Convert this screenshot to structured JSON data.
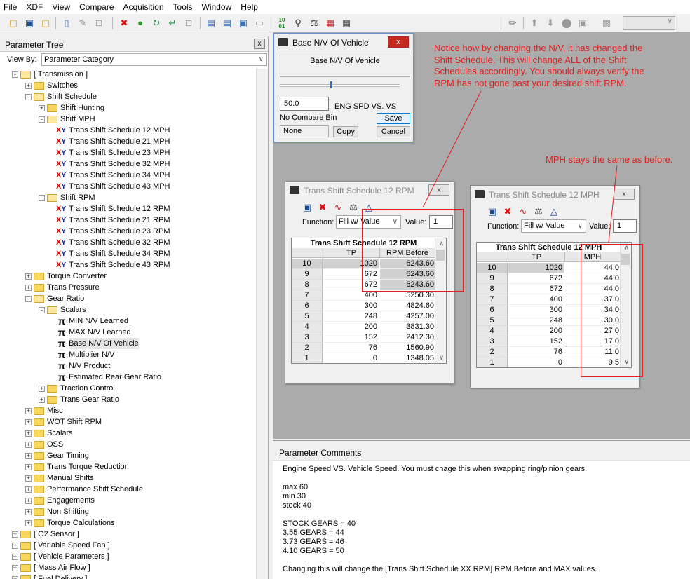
{
  "menu": [
    "File",
    "XDF",
    "View",
    "Compare",
    "Acquisition",
    "Tools",
    "Window",
    "Help"
  ],
  "left_panel": {
    "title": "Parameter Tree",
    "close_glyph": "x",
    "view_by_label": "View By:",
    "view_by_value": "Parameter Category"
  },
  "tree": [
    {
      "label": "[ Transmission ]",
      "icon": "folder-open",
      "level": 0,
      "exp": "-"
    },
    {
      "label": "Switches",
      "icon": "folder",
      "level": 1,
      "exp": "+"
    },
    {
      "label": "Shift Schedule",
      "icon": "folder-open",
      "level": 1,
      "exp": "-"
    },
    {
      "label": "Shift Hunting",
      "icon": "folder",
      "level": 2,
      "exp": "+"
    },
    {
      "label": "Shift MPH",
      "icon": "folder-open",
      "level": 2,
      "exp": "-"
    },
    {
      "label": "Trans Shift Schedule 12 MPH",
      "icon": "xy",
      "level": 3
    },
    {
      "label": "Trans Shift Schedule 21 MPH",
      "icon": "xy",
      "level": 3
    },
    {
      "label": "Trans Shift Schedule 23 MPH",
      "icon": "xy",
      "level": 3
    },
    {
      "label": "Trans Shift Schedule 32 MPH",
      "icon": "xy",
      "level": 3
    },
    {
      "label": "Trans Shift Schedule 34 MPH",
      "icon": "xy",
      "level": 3
    },
    {
      "label": "Trans Shift Schedule 43 MPH",
      "icon": "xy",
      "level": 3
    },
    {
      "label": "Shift RPM",
      "icon": "folder-open",
      "level": 2,
      "exp": "-"
    },
    {
      "label": "Trans Shift Schedule 12 RPM",
      "icon": "xy",
      "level": 3
    },
    {
      "label": "Trans Shift Schedule 21 RPM",
      "icon": "xy",
      "level": 3
    },
    {
      "label": "Trans Shift Schedule 23 RPM",
      "icon": "xy",
      "level": 3
    },
    {
      "label": "Trans Shift Schedule 32 RPM",
      "icon": "xy",
      "level": 3
    },
    {
      "label": "Trans Shift Schedule 34 RPM",
      "icon": "xy",
      "level": 3
    },
    {
      "label": "Trans Shift Schedule 43 RPM",
      "icon": "xy",
      "level": 3
    },
    {
      "label": "Torque Converter",
      "icon": "folder",
      "level": 1,
      "exp": "+"
    },
    {
      "label": "Trans Pressure",
      "icon": "folder",
      "level": 1,
      "exp": "+"
    },
    {
      "label": "Gear Ratio",
      "icon": "folder-open",
      "level": 1,
      "exp": "-"
    },
    {
      "label": "Scalars",
      "icon": "folder-open",
      "level": 2,
      "exp": "-"
    },
    {
      "label": "MIN N/V Learned",
      "icon": "pi",
      "level": 3
    },
    {
      "label": "MAX N/V Learned",
      "icon": "pi",
      "level": 3
    },
    {
      "label": "Base N/V Of Vehicle",
      "icon": "pi",
      "level": 3,
      "selected": true
    },
    {
      "label": "Multiplier N/V",
      "icon": "pi",
      "level": 3
    },
    {
      "label": "N/V Product",
      "icon": "pi",
      "level": 3
    },
    {
      "label": "Estimated Rear Gear Ratio",
      "icon": "pi",
      "level": 3
    },
    {
      "label": "Traction Control",
      "icon": "folder",
      "level": 2,
      "exp": "+"
    },
    {
      "label": "Trans Gear Ratio",
      "icon": "folder",
      "level": 2,
      "exp": "+"
    },
    {
      "label": "Misc",
      "icon": "folder",
      "level": 1,
      "exp": "+"
    },
    {
      "label": "WOT Shift RPM",
      "icon": "folder",
      "level": 1,
      "exp": "+"
    },
    {
      "label": "Scalars",
      "icon": "folder",
      "level": 1,
      "exp": "+"
    },
    {
      "label": "OSS",
      "icon": "folder",
      "level": 1,
      "exp": "+"
    },
    {
      "label": "Gear Timing",
      "icon": "folder",
      "level": 1,
      "exp": "+"
    },
    {
      "label": "Trans Torque Reduction",
      "icon": "folder",
      "level": 1,
      "exp": "+"
    },
    {
      "label": "Manual Shifts",
      "icon": "folder",
      "level": 1,
      "exp": "+"
    },
    {
      "label": "Performance Shift Schedule",
      "icon": "folder",
      "level": 1,
      "exp": "+"
    },
    {
      "label": "Engagements",
      "icon": "folder",
      "level": 1,
      "exp": "+"
    },
    {
      "label": "Non Shifting",
      "icon": "folder",
      "level": 1,
      "exp": "+"
    },
    {
      "label": "Torque Calculations",
      "icon": "folder",
      "level": 1,
      "exp": "+"
    },
    {
      "label": "[ O2 Sensor ]",
      "icon": "folder",
      "level": 0,
      "exp": "+"
    },
    {
      "label": "[ Variable Speed Fan ]",
      "icon": "folder",
      "level": 0,
      "exp": "+"
    },
    {
      "label": "[ Vehicle Parameters ]",
      "icon": "folder",
      "level": 0,
      "exp": "+"
    },
    {
      "label": "[ Mass Air Flow ]",
      "icon": "folder",
      "level": 0,
      "exp": "+"
    },
    {
      "label": "[ Fuel Delivery ]",
      "icon": "folder",
      "level": 0,
      "exp": "+"
    }
  ],
  "base_nv_window": {
    "title": "Base N/V Of Vehicle",
    "field_label": "Base N/V Of Vehicle",
    "value": "50.0",
    "unit_label": "ENG SPD VS. VS",
    "compare_label": "No Compare Bin",
    "compare_value": "None",
    "save_label": "Save",
    "copy_label": "Copy",
    "cancel_label": "Cancel",
    "close_glyph": "x"
  },
  "rpm_window": {
    "title": "Trans Shift Schedule 12 RPM",
    "function_label": "Function:",
    "function_value": "Fill w/ Value",
    "value_label": "Value:",
    "value": "1",
    "table_title": "Trans Shift Schedule 12 RPM",
    "col1": "TP",
    "col2": "RPM Before",
    "rows": [
      {
        "idx": "10",
        "tp": "1020",
        "val": "6243.60"
      },
      {
        "idx": "9",
        "tp": "672",
        "val": "6243.60"
      },
      {
        "idx": "8",
        "tp": "672",
        "val": "6243.60"
      },
      {
        "idx": "7",
        "tp": "400",
        "val": "5250.30"
      },
      {
        "idx": "6",
        "tp": "300",
        "val": "4824.60"
      },
      {
        "idx": "5",
        "tp": "248",
        "val": "4257.00"
      },
      {
        "idx": "4",
        "tp": "200",
        "val": "3831.30"
      },
      {
        "idx": "3",
        "tp": "152",
        "val": "2412.30"
      },
      {
        "idx": "2",
        "tp": "76",
        "val": "1560.90"
      },
      {
        "idx": "1",
        "tp": "0",
        "val": "1348.05"
      }
    ],
    "close_glyph": "x"
  },
  "mph_window": {
    "title": "Trans Shift Schedule 12 MPH",
    "function_label": "Function:",
    "function_value": "Fill w/ Value",
    "value_label": "Value:",
    "value": "1",
    "table_title": "Trans Shift Schedule 12 MPH",
    "col1": "TP",
    "col2": "MPH",
    "rows": [
      {
        "idx": "10",
        "tp": "1020",
        "val": "44.0"
      },
      {
        "idx": "9",
        "tp": "672",
        "val": "44.0"
      },
      {
        "idx": "8",
        "tp": "672",
        "val": "44.0"
      },
      {
        "idx": "7",
        "tp": "400",
        "val": "37.0"
      },
      {
        "idx": "6",
        "tp": "300",
        "val": "34.0"
      },
      {
        "idx": "5",
        "tp": "248",
        "val": "30.0"
      },
      {
        "idx": "4",
        "tp": "200",
        "val": "27.0"
      },
      {
        "idx": "3",
        "tp": "152",
        "val": "17.0"
      },
      {
        "idx": "2",
        "tp": "76",
        "val": "11.0"
      },
      {
        "idx": "1",
        "tp": "0",
        "val": "9.5"
      }
    ],
    "close_glyph": "x"
  },
  "annotations": {
    "top": [
      "Notice how by changing the N/V, it has changed the",
      "Shift Schedule. This will change ALL of the Shift",
      "Schedules accordingly. You should always verify the",
      "RPM has not gone past your desired shift RPM."
    ],
    "mph": "MPH stays the same as before.",
    "color": "#e02020"
  },
  "comments": {
    "title": "Parameter Comments",
    "lines": [
      "Engine Speed VS. Vehicle Speed. You must chage this when swapping ring/pinion gears.",
      "",
      "max 60",
      "min 30",
      "stock 40",
      "",
      "STOCK GEARS = 40",
      "3.55 GEARS = 44",
      "3.73 GEARS = 46",
      "4.10 GEARS = 50",
      "",
      "Changing this will change the [Trans Shift Schedule XX RPM] RPM Before and MAX values."
    ]
  },
  "icons": {
    "toolbar": [
      "open-folder-icon",
      "save-icon",
      "open-icon",
      "compare-icon",
      "eraser-icon",
      "new-icon",
      "delete-icon",
      "add-icon",
      "refresh-icon",
      "page-icon",
      "layout1-icon",
      "layout2-icon",
      "window-icon",
      "monitor-icon",
      "binary-icon",
      "search-icon",
      "scale-icon",
      "hierarchy-icon",
      "calculator-icon",
      "wand-icon",
      "arrow-up-icon",
      "arrow-down-icon",
      "circle-icon",
      "copy-icon",
      "chip-icon"
    ]
  }
}
